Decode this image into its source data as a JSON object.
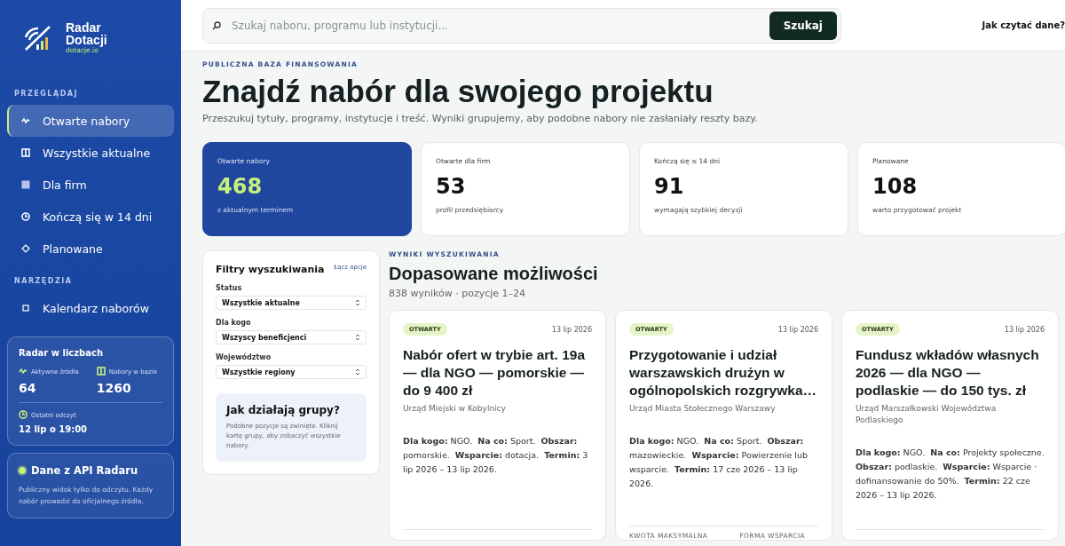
{
  "brand": {
    "name_line1": "Radar",
    "name_line2": "Dotacji",
    "domain": "dotacje.io"
  },
  "nav_sections": [
    {
      "heading": "PRZEGLĄDAJ",
      "items": [
        {
          "label": "Otwarte nabory",
          "kind": "pulse",
          "selected": true
        },
        {
          "label": "Wszystkie aktualne",
          "kind": "columns",
          "selected": false
        },
        {
          "label": "Dla firm",
          "kind": "square",
          "selected": false
        },
        {
          "label": "Kończą się w 14 dni",
          "kind": "clock",
          "selected": false
        },
        {
          "label": "Planowane",
          "kind": "diamond",
          "selected": false
        }
      ]
    },
    {
      "heading": "NARZĘDZIA",
      "items": [
        {
          "label": "Kalendarz naborów",
          "kind": "outline",
          "selected": false
        }
      ]
    }
  ],
  "radar_stats": {
    "title": "Radar w liczbach",
    "sources_label": "Aktywne źródła",
    "sources_value": "64",
    "base_label": "Nabory w bazie",
    "base_value": "1260",
    "last_read_label": "Ostatni odczyt",
    "last_read_value": "12 lip o 19:00"
  },
  "api_box": {
    "title": "Dane z API Radaru",
    "text": "Publiczny widok tylko do odczytu. Każdy nabór prowadzi do oficjalnego źródła."
  },
  "search": {
    "placeholder": "Szukaj naboru, programu lub instytucji...",
    "button": "Szukaj"
  },
  "help_link": "Jak czytać dane?",
  "eyebrow": "PUBLICZNA BAZA FINANSOWANIA",
  "headline": "Znajdź nabór dla swojego projektu",
  "subtitle": "Przeszukuj tytuły, programy, instytucje i treść. Wyniki grupujemy, aby podobne nabory nie zasłaniały reszty bazy.",
  "stat_cards": [
    {
      "label": "Otwarte nabory",
      "value": "468",
      "note": "z aktualnym terminem",
      "selected": true
    },
    {
      "label": "Otwarte dla firm",
      "value": "53",
      "note": "profil przedsiębiorcy",
      "selected": false
    },
    {
      "label": "Kończą się ≤ 14 dni",
      "value": "91",
      "note": "wymagają szybkiej decyzji",
      "selected": false
    },
    {
      "label": "Planowane",
      "value": "108",
      "note": "warto przygotować projekt",
      "selected": false
    }
  ],
  "filters": {
    "title": "Filtry wyszukiwania",
    "combine_link": "Łącz opcje",
    "fields": [
      {
        "label": "Status",
        "value": "Wszystkie aktualne"
      },
      {
        "label": "Dla kogo",
        "value": "Wszyscy beneficjenci"
      },
      {
        "label": "Województwo",
        "value": "Wszystkie regiony"
      }
    ],
    "info_title": "Jak działają grupy?",
    "info_text": "Podobne pozycje są zwinięte. Kliknij kartę grupy, aby zobaczyć wszystkie nabory."
  },
  "results": {
    "eyebrow": "WYNIKI WYSZUKIWANIA",
    "title": "Dopasowane możliwości",
    "count": "838 wyników · pozycje 1–24",
    "cards": [
      {
        "status": "OTWARTY",
        "date": "13 lip 2026",
        "title": "Nabór ofert w trybie art. 19a — dla NGO — pomorskie — do 9 400 zł",
        "institution": "Urząd Miejski w Kobylnicy",
        "details": "**Dla kogo:** NGO.  **Na co:** Sport.  **Obszar:** pomorskie.  **Wsparcie:** dotacja.  **Termin:** 3 lip 2026 – 13 lip 2026."
      },
      {
        "status": "OTWARTY",
        "date": "13 lip 2026",
        "title": "Przygotowanie i udział warszawskich drużyn w ogólnopolskich rozgrywka…",
        "institution": "Urząd Miasta Stołecznego Warszawy",
        "details": "**Dla kogo:** NGO.  **Na co:** Sport.  **Obszar:** mazowieckie.  **Wsparcie:** Powierzenie lub wsparcie.  **Termin:** 17 cze 2026 – 13 lip 2026.",
        "footer": [
          "KWOTA MAKSYMALNA",
          "FORMA WSPARCIA"
        ]
      },
      {
        "status": "OTWARTY",
        "date": "13 lip 2026",
        "title": "Fundusz wkładów własnych 2026 — dla NGO — podlaskie — do 150 tys. zł",
        "institution": "Urząd Marszałkowski Województwa Podlaskiego",
        "details": "**Dla kogo:** NGO.  **Na co:** Projekty społeczne.  **Obszar:** podlaskie.  **Wsparcie:** Wsparcie · dofinansowanie do 50%.  **Termin:** 22 cze 2026 – 13 lip 2026."
      }
    ]
  }
}
